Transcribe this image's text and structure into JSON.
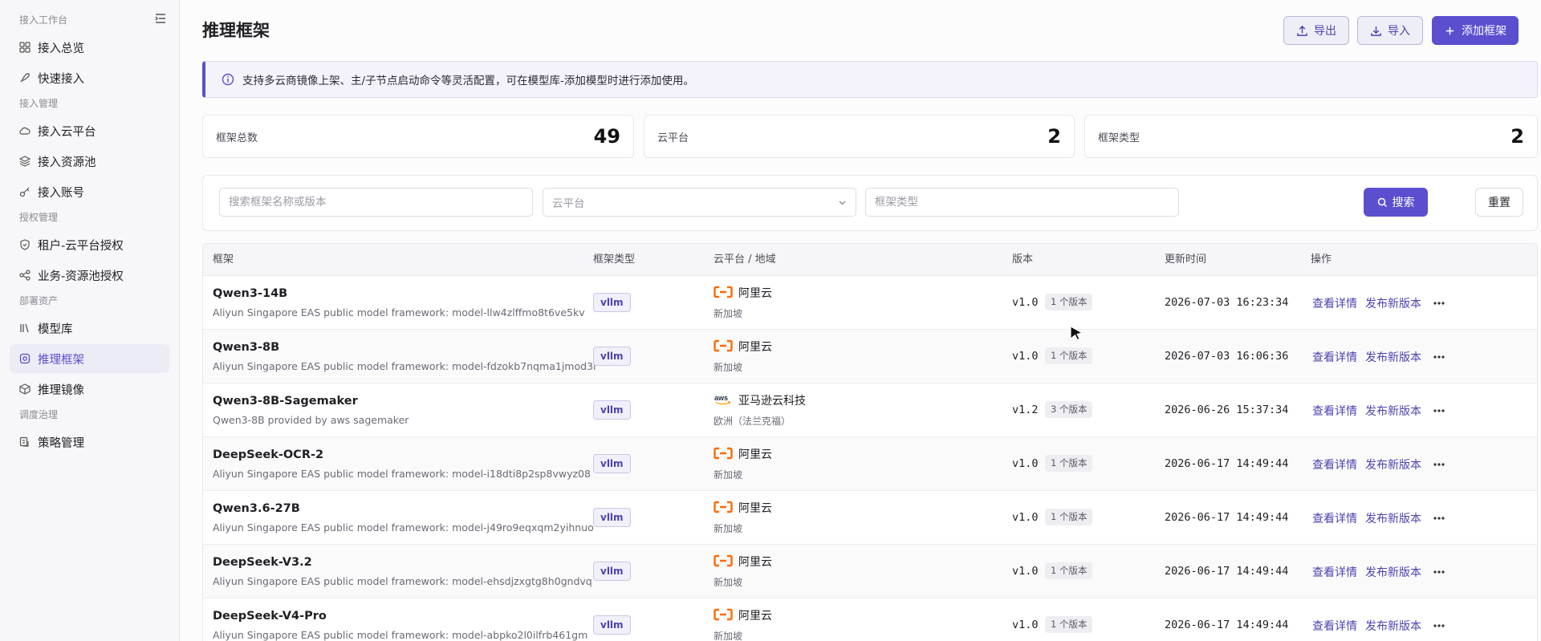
{
  "sidebar": {
    "groups": [
      "接入工作台",
      "接入管理",
      "授权管理",
      "部署资产",
      "调度治理"
    ],
    "items": [
      {
        "label": "接入总览",
        "icon": "grid-icon"
      },
      {
        "label": "快速接入",
        "icon": "rocket-icon"
      },
      {
        "label": "接入云平台",
        "icon": "cloud-icon"
      },
      {
        "label": "接入资源池",
        "icon": "layers-icon"
      },
      {
        "label": "接入账号",
        "icon": "key-icon"
      },
      {
        "label": "租户-云平台授权",
        "icon": "shield-icon"
      },
      {
        "label": "业务-资源池授权",
        "icon": "share-icon"
      },
      {
        "label": "模型库",
        "icon": "library-icon"
      },
      {
        "label": "推理框架",
        "icon": "cog-icon"
      },
      {
        "label": "推理镜像",
        "icon": "package-icon"
      },
      {
        "label": "策略管理",
        "icon": "policy-icon"
      }
    ],
    "active": "推理框架"
  },
  "header": {
    "title": "推理框架",
    "export_label": "导出",
    "import_label": "导入",
    "add_label": "添加框架"
  },
  "notice": "支持多云商镜像上架、主/子节点启动命令等灵活配置，可在模型库-添加模型时进行添加使用。",
  "stats": [
    {
      "label": "框架总数",
      "value": "49"
    },
    {
      "label": "云平台",
      "value": "2"
    },
    {
      "label": "框架类型",
      "value": "2"
    }
  ],
  "filters": {
    "search_placeholder": "搜索框架名称或版本",
    "platform_placeholder": "云平台",
    "type_placeholder": "框架类型",
    "search_label": "搜索",
    "reset_label": "重置"
  },
  "table": {
    "columns": [
      "框架",
      "框架类型",
      "云平台 / 地域",
      "版本",
      "更新时间",
      "操作"
    ],
    "view_label": "查看详情",
    "publish_label": "发布新版本",
    "rows": [
      {
        "name": "Qwen3-14B",
        "desc": "Aliyun Singapore EAS public model framework: model-llw4zlffmo8t6ve5kv",
        "type": "vllm",
        "platform": "阿里云",
        "platform_logo": "aliyun-logo-icon",
        "region": "新加坡",
        "version": "v1.0",
        "version_count": "1 个版本",
        "updated": "2026-07-03 16:23:34"
      },
      {
        "name": "Qwen3-8B",
        "desc": "Aliyun Singapore EAS public model framework: model-fdzokb7nqma1jmod3l",
        "type": "vllm",
        "platform": "阿里云",
        "platform_logo": "aliyun-logo-icon",
        "region": "新加坡",
        "version": "v1.0",
        "version_count": "1 个版本",
        "updated": "2026-07-03 16:06:36"
      },
      {
        "name": "Qwen3-8B-Sagemaker",
        "desc": "Qwen3-8B provided by aws sagemaker",
        "type": "vllm",
        "platform": "亚马逊云科技",
        "platform_logo": "aws-logo-icon",
        "region": "欧洲（法兰克福）",
        "version": "v1.2",
        "version_count": "3 个版本",
        "updated": "2026-06-26 15:37:34"
      },
      {
        "name": "DeepSeek-OCR-2",
        "desc": "Aliyun Singapore EAS public model framework: model-i18dti8p2sp8vwyz08",
        "type": "vllm",
        "platform": "阿里云",
        "platform_logo": "aliyun-logo-icon",
        "region": "新加坡",
        "version": "v1.0",
        "version_count": "1 个版本",
        "updated": "2026-06-17 14:49:44"
      },
      {
        "name": "Qwen3.6-27B",
        "desc": "Aliyun Singapore EAS public model framework: model-j49ro9eqxqm2yihnuo",
        "type": "vllm",
        "platform": "阿里云",
        "platform_logo": "aliyun-logo-icon",
        "region": "新加坡",
        "version": "v1.0",
        "version_count": "1 个版本",
        "updated": "2026-06-17 14:49:44"
      },
      {
        "name": "DeepSeek-V3.2",
        "desc": "Aliyun Singapore EAS public model framework: model-ehsdjzxgtg8h0gndvq",
        "type": "vllm",
        "platform": "阿里云",
        "platform_logo": "aliyun-logo-icon",
        "region": "新加坡",
        "version": "v1.0",
        "version_count": "1 个版本",
        "updated": "2026-06-17 14:49:44"
      },
      {
        "name": "DeepSeek-V4-Pro",
        "desc": "Aliyun Singapore EAS public model framework: model-abpko2l0ilfrb461gm",
        "type": "vllm",
        "platform": "阿里云",
        "platform_logo": "aliyun-logo-icon",
        "region": "新加坡",
        "version": "v1.0",
        "version_count": "1 个版本",
        "updated": "2026-06-17 14:49:44"
      }
    ]
  },
  "colors": {
    "accent": "#5b4fcf",
    "aliyun": "#ff6a00",
    "aws": "#232f3e"
  }
}
